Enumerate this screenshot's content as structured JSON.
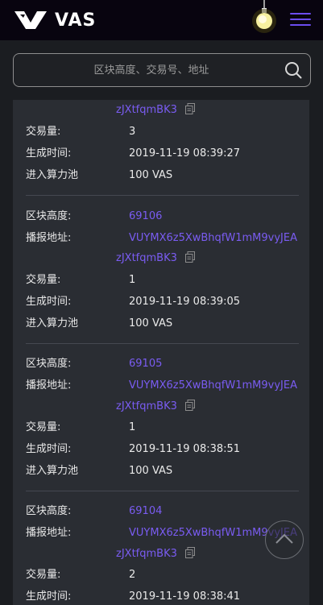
{
  "header": {
    "logo_text": "VAS"
  },
  "search": {
    "placeholder": "区块高度、交易号、地址"
  },
  "labels": {
    "height": "区块高度:",
    "address": "播报地址:",
    "tx_count": "交易量:",
    "time": "生成时间:",
    "pool": "进入算力池"
  },
  "partial_block": {
    "address_line2": "zJXtfqmBK3",
    "tx_count": "3",
    "time": "2019-11-19 08:39:27",
    "pool": "100  VAS"
  },
  "blocks": [
    {
      "height": "69106",
      "address_line1": "VUYMX6z5XwBhqfW1mM9vyJEA",
      "address_line2": "zJXtfqmBK3",
      "tx_count": "1",
      "time": "2019-11-19 08:39:05",
      "pool": "100  VAS"
    },
    {
      "height": "69105",
      "address_line1": "VUYMX6z5XwBhqfW1mM9vyJEA",
      "address_line2": "zJXtfqmBK3",
      "tx_count": "1",
      "time": "2019-11-19 08:38:51",
      "pool": "100  VAS"
    },
    {
      "height": "69104",
      "address_line1": "VUYMX6z5XwBhqfW1mM9vyJEA",
      "address_line2": "zJXtfqmBK3",
      "tx_count": "2",
      "time": "2019-11-19 08:38:41"
    }
  ],
  "icons": {
    "logo": "vas-logo-icon",
    "theme": "lightbulb-icon",
    "menu": "hamburger-menu-icon",
    "search": "search-icon",
    "copy": "copy-icon",
    "back_to_top": "chevron-up-icon"
  },
  "colors": {
    "accent": "#7a5cf2",
    "header_bg": "#08040f",
    "card_bg": "#2a2d33"
  }
}
